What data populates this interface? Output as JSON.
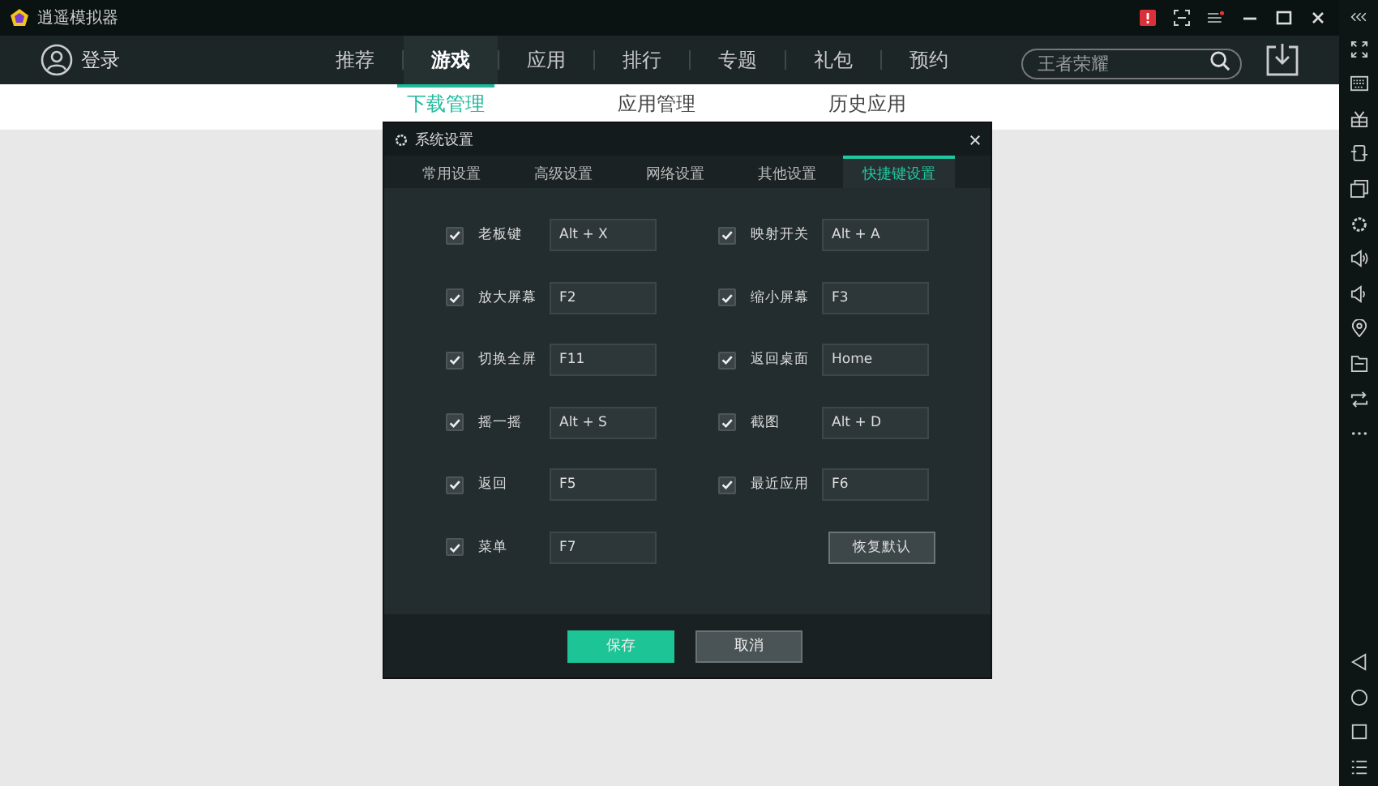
{
  "window": {
    "title": "逍遥模拟器"
  },
  "nav": {
    "login": "登录",
    "tabs": [
      {
        "label": "推荐",
        "selected": false
      },
      {
        "label": "游戏",
        "selected": true
      },
      {
        "label": "应用",
        "selected": false
      },
      {
        "label": "排行",
        "selected": false
      },
      {
        "label": "专题",
        "selected": false
      },
      {
        "label": "礼包",
        "selected": false
      },
      {
        "label": "预约",
        "selected": false
      }
    ],
    "search": {
      "placeholder": "王者荣耀"
    }
  },
  "sub_tabs": [
    {
      "label": "下载管理",
      "selected": true
    },
    {
      "label": "应用管理",
      "selected": false
    },
    {
      "label": "历史应用",
      "selected": false
    }
  ],
  "dialog": {
    "title": "系统设置",
    "tabs": [
      {
        "label": "常用设置",
        "selected": false
      },
      {
        "label": "高级设置",
        "selected": false
      },
      {
        "label": "网络设置",
        "selected": false
      },
      {
        "label": "其他设置",
        "selected": false
      },
      {
        "label": "快捷键设置",
        "selected": true
      }
    ],
    "shortcuts": [
      {
        "label": "老板键",
        "checked": true,
        "value": "Alt + X"
      },
      {
        "label": "映射开关",
        "checked": true,
        "value": "Alt + A"
      },
      {
        "label": "放大屏幕",
        "checked": true,
        "value": "F2"
      },
      {
        "label": "缩小屏幕",
        "checked": true,
        "value": "F3"
      },
      {
        "label": "切换全屏",
        "checked": true,
        "value": "F11"
      },
      {
        "label": "返回桌面",
        "checked": true,
        "value": "Home"
      },
      {
        "label": "摇一摇",
        "checked": true,
        "value": "Alt + S"
      },
      {
        "label": "截图",
        "checked": true,
        "value": "Alt + D"
      },
      {
        "label": "返回",
        "checked": true,
        "value": "F5"
      },
      {
        "label": "最近应用",
        "checked": true,
        "value": "F6"
      },
      {
        "label": "菜单",
        "checked": true,
        "value": "F7"
      }
    ],
    "reset_button": "恢复默认",
    "buttons": [
      {
        "label": "保存",
        "kind": "primary"
      },
      {
        "label": "取消",
        "kind": "secondary"
      }
    ]
  }
}
